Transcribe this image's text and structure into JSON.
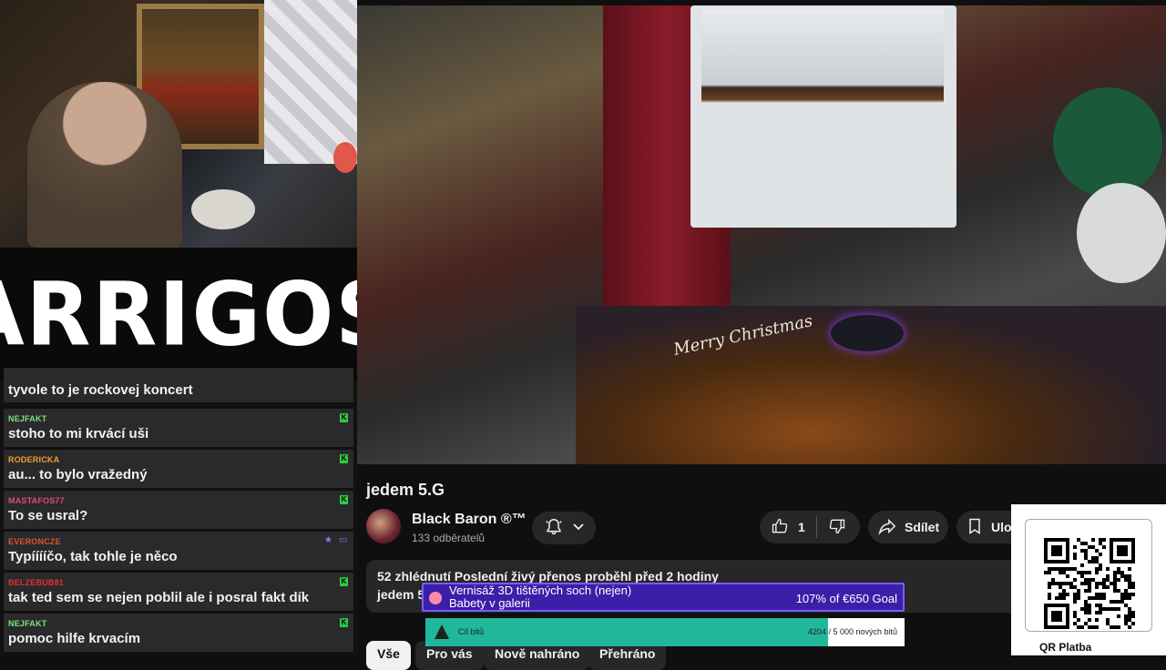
{
  "logo": {
    "text": "ARRIGOS"
  },
  "chat": {
    "messages": [
      {
        "user": "",
        "text": "tyvole to je rockovej koncert",
        "color": "#ffffff",
        "badges": []
      },
      {
        "user": "NEJFAKT",
        "text": "stoho to mi krvácí uši",
        "color": "#7ee07e",
        "badges": [
          "green"
        ]
      },
      {
        "user": "RODERICKA",
        "text": "au... to bylo vražedný",
        "color": "#f0a030",
        "badges": [
          "green"
        ]
      },
      {
        "user": "MASTAFOS77",
        "text": "To se usral?",
        "color": "#e04a70",
        "badges": [
          "green"
        ]
      },
      {
        "user": "EVERONCZE",
        "text": "Typííííčo, tak tohle je něco",
        "color": "#e05030",
        "badges": [
          "star",
          "chat"
        ]
      },
      {
        "user": "BELZEBUB81",
        "text": "tak ted sem se nejen poblil ale i posral fakt dík",
        "color": "#e03030",
        "badges": [
          "green"
        ]
      },
      {
        "user": "NEJFAKT",
        "text": "pomoc hilfe krvacím",
        "color": "#7ee07e",
        "badges": [
          "green"
        ]
      }
    ]
  },
  "video": {
    "mat_text": "Merry Christmas"
  },
  "watch": {
    "title": "jedem 5.G",
    "channel": "Black Baron ®™",
    "subscribers": "133 odběratelů",
    "likes": "1",
    "share_label": "Sdílet",
    "save_label": "Ulož",
    "description_meta": "52 zhlédnutí  Poslední živý přenos proběhl před 2 hodiny",
    "description_line": "jedem 5",
    "chips": [
      "Vše",
      "Pro vás",
      "Nově nahráno",
      "Přehráno"
    ]
  },
  "goal1": {
    "title_line1": "Vernisáž 3D tištěných soch (nejen)",
    "title_line2": "Babety v galerii",
    "progress": "107% of €650 Goal"
  },
  "goal2": {
    "label": "Cíl bitů",
    "value": "4204 / 5 000 nových bitů",
    "fraction": 0.8408
  },
  "qr": {
    "label": "QR Platba"
  },
  "colors": {
    "accent_green": "#2ecc40",
    "goal_purple": "#3b1fa8",
    "goal_teal": "#1fb89a"
  }
}
